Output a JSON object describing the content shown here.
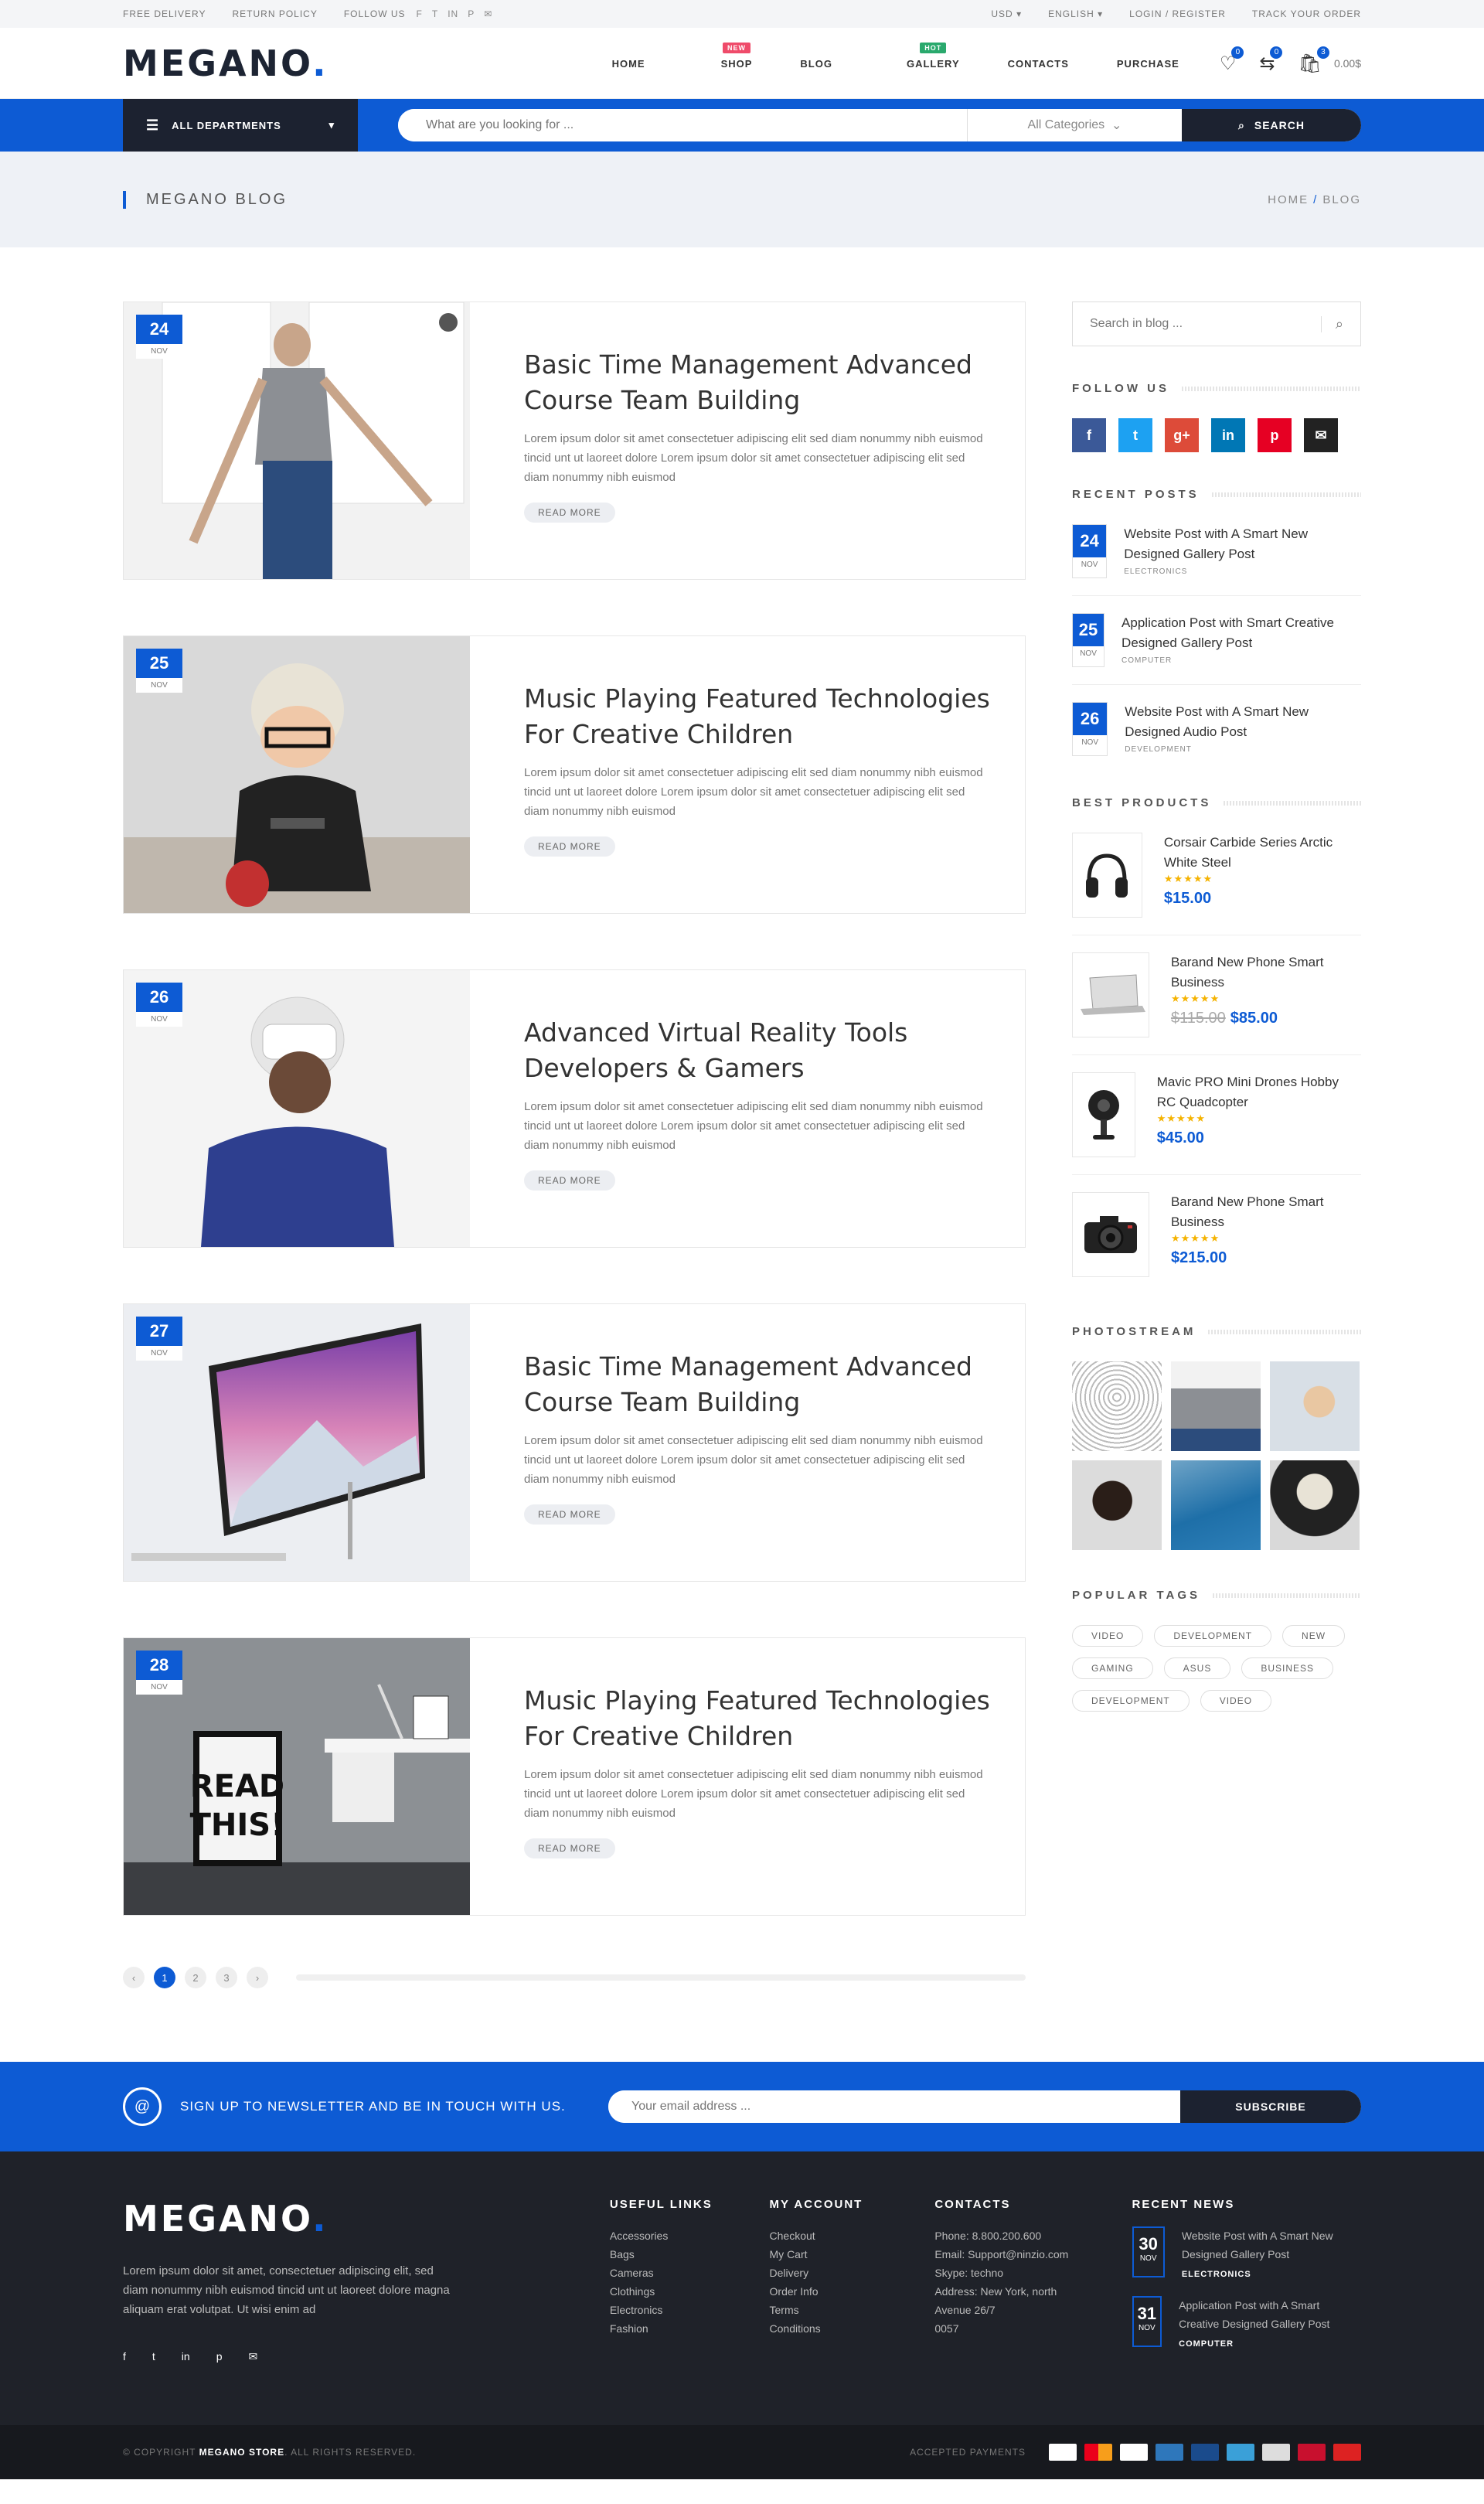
{
  "topbar": {
    "free_delivery": "FREE DELIVERY",
    "return_policy": "RETURN POLICY",
    "follow_us": "FOLLOW US",
    "currency": "USD",
    "language": "ENGLISH",
    "login": "LOGIN / REGISTER",
    "track": "TRACK YOUR ORDER"
  },
  "header": {
    "logo": "MEGANO",
    "logo_dot": ".",
    "nav": [
      {
        "label": "HOME"
      },
      {
        "label": "SHOP",
        "badge": "NEW"
      },
      {
        "label": "BLOG"
      },
      {
        "label": "GALLERY",
        "badge": "HOT"
      },
      {
        "label": "CONTACTS"
      },
      {
        "label": "PURCHASE"
      }
    ],
    "wishlist_count": "0",
    "compare_count": "0",
    "cart_count": "3",
    "cart_total": "0.00$"
  },
  "searchbar": {
    "departments": "ALL DEPARTMENTS",
    "placeholder": "What are you looking for ...",
    "category": "All Categories",
    "button": "SEARCH"
  },
  "banner": {
    "title": "MEGANO BLOG",
    "crumb_home": "HOME",
    "crumb_sep": "/",
    "crumb_current": "BLOG"
  },
  "posts": [
    {
      "day": "24",
      "month": "NOV",
      "title": "Basic Time Management Advanced Course Team Building",
      "excerpt": "Lorem ipsum dolor sit amet consectetuer adipiscing elit sed diam nonummy nibh euismod tincid  unt ut laoreet dolore Lorem ipsum dolor sit amet consectetuer adipiscing elit sed diam nonummy nibh euismod",
      "read_more": "READ MORE"
    },
    {
      "day": "25",
      "month": "NOV",
      "title": "Music Playing Featured Technologies For Creative Children",
      "excerpt": "Lorem ipsum dolor sit amet consectetuer adipiscing elit sed diam nonummy nibh euismod tincid  unt ut laoreet dolore Lorem ipsum dolor sit amet consectetuer adipiscing elit sed diam nonummy nibh euismod",
      "read_more": "READ MORE"
    },
    {
      "day": "26",
      "month": "NOV",
      "title": "Advanced Virtual Reality Tools Developers & Gamers",
      "excerpt": "Lorem ipsum dolor sit amet consectetuer adipiscing elit sed diam nonummy nibh euismod tincid  unt ut laoreet dolore Lorem ipsum dolor sit amet consectetuer adipiscing elit sed diam nonummy nibh euismod",
      "read_more": "READ MORE"
    },
    {
      "day": "27",
      "month": "NOV",
      "title": "Basic Time Management Advanced Course Team Building",
      "excerpt": "Lorem ipsum dolor sit amet consectetuer adipiscing elit sed diam nonummy nibh euismod tincid  unt ut laoreet dolore Lorem ipsum dolor sit amet consectetuer adipiscing elit sed diam nonummy nibh euismod",
      "read_more": "READ MORE"
    },
    {
      "day": "28",
      "month": "NOV",
      "title": "Music Playing Featured Technologies For Creative Children",
      "excerpt": "Lorem ipsum dolor sit amet consectetuer adipiscing elit sed diam nonummy nibh euismod tincid  unt ut laoreet dolore Lorem ipsum dolor sit amet consectetuer adipiscing elit sed diam nonummy nibh euismod",
      "read_more": "READ MORE"
    }
  ],
  "pagination": {
    "pages": [
      "1",
      "2",
      "3"
    ],
    "prev": "‹",
    "next": "›"
  },
  "sidebar": {
    "search_placeholder": "Search in blog ...",
    "follow_title": "FOLLOW US",
    "recent_title": "RECENT POSTS",
    "recent": [
      {
        "day": "24",
        "month": "NOV",
        "title": "Website Post with A Smart New Designed Gallery Post",
        "cat": "ELECTRONICS"
      },
      {
        "day": "25",
        "month": "NOV",
        "title": "Application Post with Smart Creative Designed Gallery Post",
        "cat": "COMPUTER"
      },
      {
        "day": "26",
        "month": "NOV",
        "title": "Website Post with A Smart New Designed Audio Post",
        "cat": "DEVELOPMENT"
      }
    ],
    "best_title": "BEST PRODUCTS",
    "products": [
      {
        "name": "Corsair Carbide Series Arctic White Steel",
        "old": "",
        "price": "$15.00",
        "icon": "headphones-icon"
      },
      {
        "name": "Barand New Phone Smart Business",
        "old": "$115.00",
        "price": "$85.00",
        "icon": "laptop-icon"
      },
      {
        "name": "Mavic PRO Mini Drones Hobby RC Quadcopter",
        "old": "",
        "price": "$45.00",
        "icon": "camera-icon"
      },
      {
        "name": "Barand New Phone Smart Business",
        "old": "",
        "price": "$215.00",
        "icon": "dslr-icon"
      }
    ],
    "stars": "★★★★★",
    "photostream_title": "PHOTOSTREAM",
    "tags_title": "POPULAR TAGS",
    "tags": [
      "VIDEO",
      "DEVELOPMENT",
      "NEW",
      "GAMING",
      "ASUS",
      "BUSINESS",
      "DEVELOPMENT",
      "VIDEO"
    ]
  },
  "newsletter": {
    "text": "SIGN UP TO NEWSLETTER AND BE IN TOUCH WITH US.",
    "placeholder": "Your email address ...",
    "button": "SUBSCRIBE"
  },
  "footer": {
    "logo": "MEGANO",
    "logo_dot": ".",
    "desc": "Lorem ipsum dolor sit amet, consectetuer adipiscing elit, sed diam nonummy nibh euismod tincid  unt ut laoreet dolore magna aliquam erat volutpat. Ut wisi enim ad",
    "useful_title": "USEFUL LINKS",
    "useful": [
      "Accessories",
      "Bags",
      "Cameras",
      "Clothings",
      "Electronics",
      "Fashion"
    ],
    "account_title": "MY ACCOUNT",
    "account": [
      "Checkout",
      "My Cart",
      "Delivery",
      "Order Info",
      "Terms",
      "Conditions"
    ],
    "contacts_title": "CONTACTS",
    "contacts": [
      "Phone: 8.800.200.600",
      "Email: Support@ninzio.com",
      "Skype: techno",
      "Address: New York, north",
      "Avenue 26/7",
      "0057"
    ],
    "news_title": "RECENT NEWS",
    "news": [
      {
        "day": "30",
        "month": "NOV",
        "title": "Website Post with A Smart New Designed Gallery Post",
        "cat": "ELECTRONICS"
      },
      {
        "day": "31",
        "month": "NOV",
        "title": "Application Post with A Smart Creative Designed Gallery Post",
        "cat": "COMPUTER"
      }
    ],
    "copyright_pre": "© COPYRIGHT",
    "copyright_brand": "MEGANO STORE",
    "copyright_post": ". ALL RIGHTS RESERVED.",
    "payments": "ACCEPTED PAYMENTS"
  }
}
